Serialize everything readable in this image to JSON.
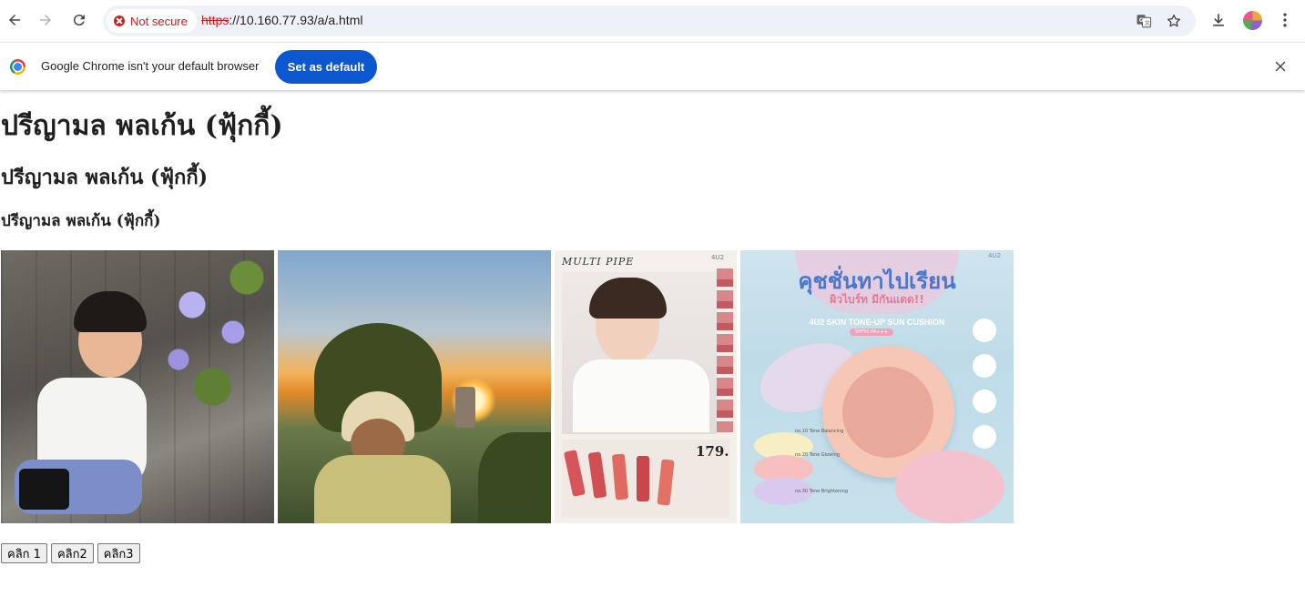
{
  "browser": {
    "security_label": "Not secure",
    "url_scheme": "https",
    "url_rest": "://10.160.77.93/a/a.html",
    "icons": [
      "back-icon",
      "forward-icon",
      "reload-icon",
      "translate-icon",
      "bookmark-star-icon",
      "download-icon",
      "profile-avatar",
      "menu-icon"
    ]
  },
  "infobar": {
    "message": "Google Chrome isn't your default browser",
    "button_label": "Set as default",
    "button_color": "#0b57d0"
  },
  "page": {
    "h1": "ปรีญามล พลเก้น (ฟุ้กกี้)",
    "h2": "ปรีญามล พลเก้น (ฟุ้กกี้)",
    "h3": "ปรีญามล พลเก้น (ฟุ้กกี้)",
    "images": {
      "photo3": {
        "brand": "4U2",
        "headline": "MULTI PIPE",
        "price": "179."
      },
      "photo4": {
        "brand": "4U2",
        "headline": "คุชชั่นทาไปเรียน",
        "subheadline": "ผิวไบร์ท มีกันแดด!!",
        "product": "4U2 SKIN TONE-UP SUN CUSHION",
        "spf": "SPF50 PA+++",
        "shades": [
          "no.10 Tone Balancing",
          "no.20 Tone Glowing",
          "no.30 Tone Brightening"
        ]
      }
    },
    "buttons": [
      "คลิก 1",
      "คลิก2",
      "คลิก3"
    ]
  }
}
